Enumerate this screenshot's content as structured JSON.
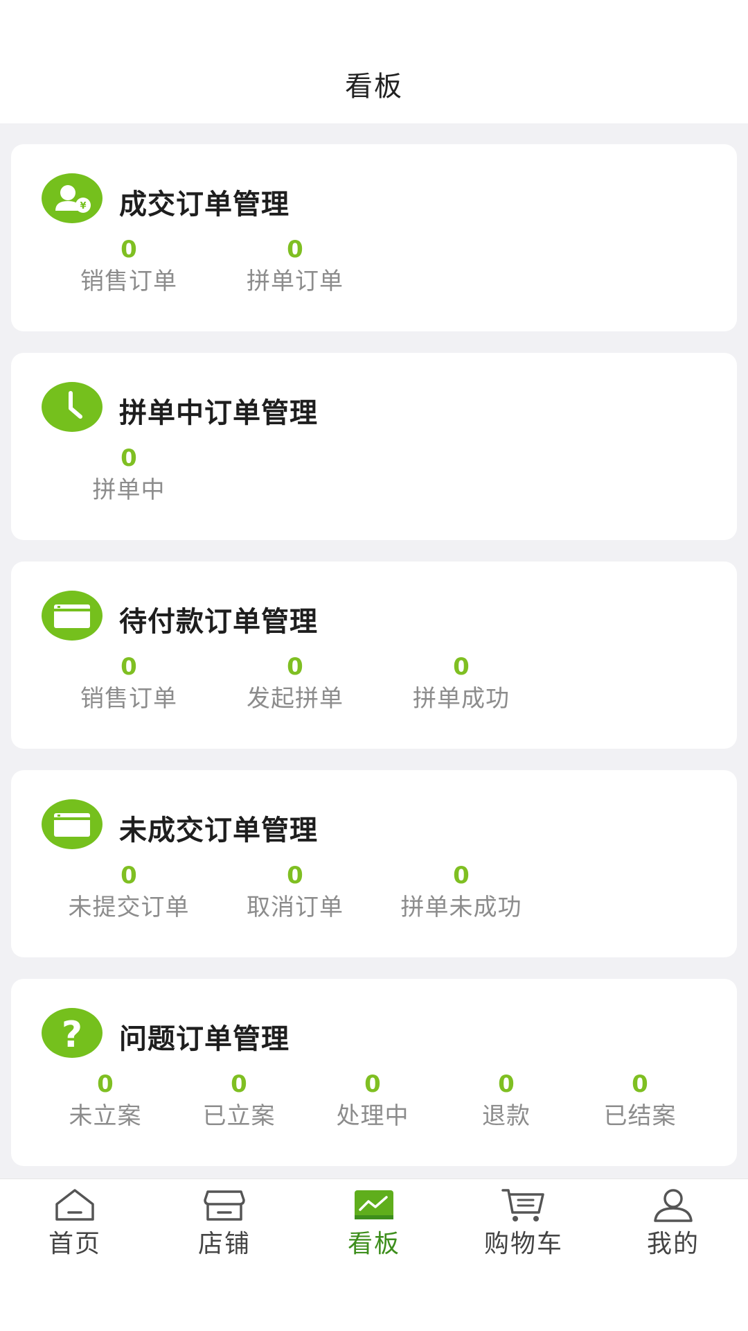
{
  "header": {
    "title": "看板"
  },
  "cards": [
    {
      "title": "成交订单管理",
      "icon": "user-coin-icon",
      "stats": [
        {
          "value": "0",
          "label": "销售订单"
        },
        {
          "value": "0",
          "label": "拼单订单"
        }
      ]
    },
    {
      "title": "拼单中订单管理",
      "icon": "clock-icon",
      "stats": [
        {
          "value": "0",
          "label": "拼单中"
        }
      ]
    },
    {
      "title": "待付款订单管理",
      "icon": "card-icon",
      "stats": [
        {
          "value": "0",
          "label": "销售订单"
        },
        {
          "value": "0",
          "label": "发起拼单"
        },
        {
          "value": "0",
          "label": "拼单成功"
        }
      ]
    },
    {
      "title": "未成交订单管理",
      "icon": "card-icon",
      "stats": [
        {
          "value": "0",
          "label": "未提交订单"
        },
        {
          "value": "0",
          "label": "取消订单"
        },
        {
          "value": "0",
          "label": "拼单未成功"
        }
      ]
    },
    {
      "title": "问题订单管理",
      "icon": "question-icon",
      "stats": [
        {
          "value": "0",
          "label": "未立案"
        },
        {
          "value": "0",
          "label": "已立案"
        },
        {
          "value": "0",
          "label": "处理中"
        },
        {
          "value": "0",
          "label": "退款"
        },
        {
          "value": "0",
          "label": "已结案"
        }
      ]
    }
  ],
  "tabbar": {
    "items": [
      {
        "label": "首页",
        "icon": "home-icon"
      },
      {
        "label": "店铺",
        "icon": "store-icon"
      },
      {
        "label": "看板",
        "icon": "dashboard-icon",
        "active": true
      },
      {
        "label": "购物车",
        "icon": "cart-icon"
      },
      {
        "label": "我的",
        "icon": "profile-icon"
      }
    ]
  },
  "colors": {
    "accent": "#75c01d",
    "number": "#7fbf22",
    "active_tab": "#3d8e1c",
    "label": "#8c8c8c"
  }
}
